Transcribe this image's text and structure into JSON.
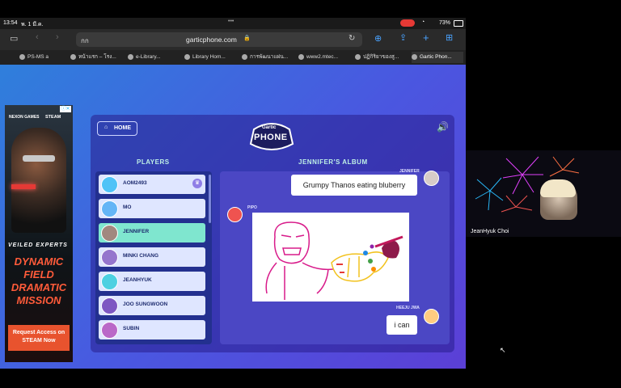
{
  "status": {
    "time": "13:54",
    "date": "พ. 1 มี.ค.",
    "battery": "73%"
  },
  "browser": {
    "url": "garticphone.com",
    "address_left_text": "กก",
    "tabs": [
      {
        "label": "PS-MS a"
      },
      {
        "label": "หน้าแรก – โรง..."
      },
      {
        "label": "e-Library..."
      },
      {
        "label": "Library Hom..."
      },
      {
        "label": "การพัฒนาแผ่น..."
      },
      {
        "label": "www2.mtec..."
      },
      {
        "label": "ปฏิกิริยาของสู..."
      },
      {
        "label": "Gartic Phon..."
      }
    ]
  },
  "ad": {
    "brand1": "NEXON GAMES",
    "brand2": "STEAM",
    "game_logo": "VEILED EXPERTS",
    "headline": [
      "DYNAMIC",
      "FIELD",
      "DRAMATIC",
      "MISSION"
    ],
    "cta": "Request Access on STEAM Now"
  },
  "game": {
    "home_label": "HOME",
    "logo_line1": "Gartic",
    "logo_line2": "PHONE",
    "players_title": "PLAYERS",
    "album_title": "JENNIFER'S ALBUM",
    "players": [
      {
        "name": "AOM2493",
        "color": "#4fc3f7"
      },
      {
        "name": "MO",
        "color": "#64b5f6"
      },
      {
        "name": "JENNIFER",
        "color": "#a1887f"
      },
      {
        "name": "MINKI CHANG",
        "color": "#9575cd"
      },
      {
        "name": "JEANHYUK",
        "color": "#4dd0e1"
      },
      {
        "name": "JOO SUNGWOON",
        "color": "#7e57c2"
      },
      {
        "name": "SUBIN",
        "color": "#ba68c8"
      }
    ],
    "messages": {
      "m1_author": "JENNIFER",
      "m1_text": "Grumpy Thanos eating bluberry",
      "m2_author": "PIPO",
      "m3_author": "HEEJU JWA",
      "m3_text": "i can"
    }
  },
  "webcam": {
    "name": "JeanHyuk Choi"
  }
}
